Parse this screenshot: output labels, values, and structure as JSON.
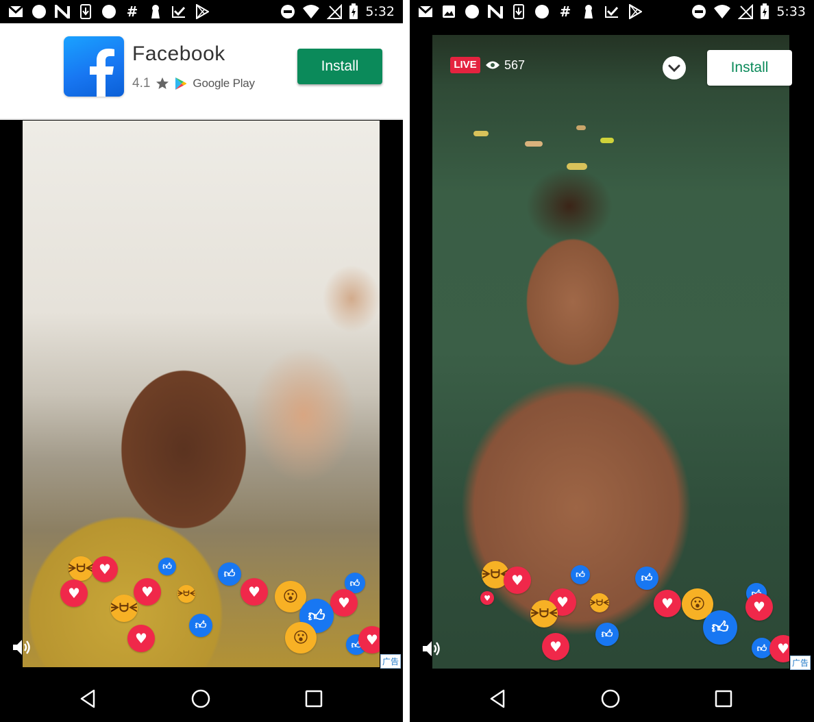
{
  "left_screen": {
    "status_bar": {
      "time": "5:32",
      "icons": [
        "gmail-icon",
        "circle-icon",
        "n-icon",
        "download-icon",
        "circle-icon",
        "hash-icon",
        "keyhole-icon",
        "tick-icon",
        "play-store-icon"
      ]
    },
    "install_banner": {
      "app_name": "Facebook",
      "rating": "4.1",
      "store": "Google Play",
      "install_label": "Install",
      "install_color": "#0b8a5a"
    },
    "ad_badge": "广告"
  },
  "right_screen": {
    "status_bar": {
      "time": "5:33",
      "icons": [
        "gmail-icon",
        "image-icon",
        "circle-icon",
        "n-icon",
        "download-icon",
        "circle-icon",
        "hash-icon",
        "keyhole-icon",
        "tick-icon",
        "play-store-icon"
      ]
    },
    "live_label": "LIVE",
    "viewer_count": "567",
    "install_label": "Install",
    "ad_badge": "广告"
  },
  "colors": {
    "install_green": "#0b8a5a",
    "live_red": "#e4233f",
    "reaction_heart": "#f0284a",
    "reaction_like": "#1877f2",
    "reaction_haha": "#f7b125"
  }
}
